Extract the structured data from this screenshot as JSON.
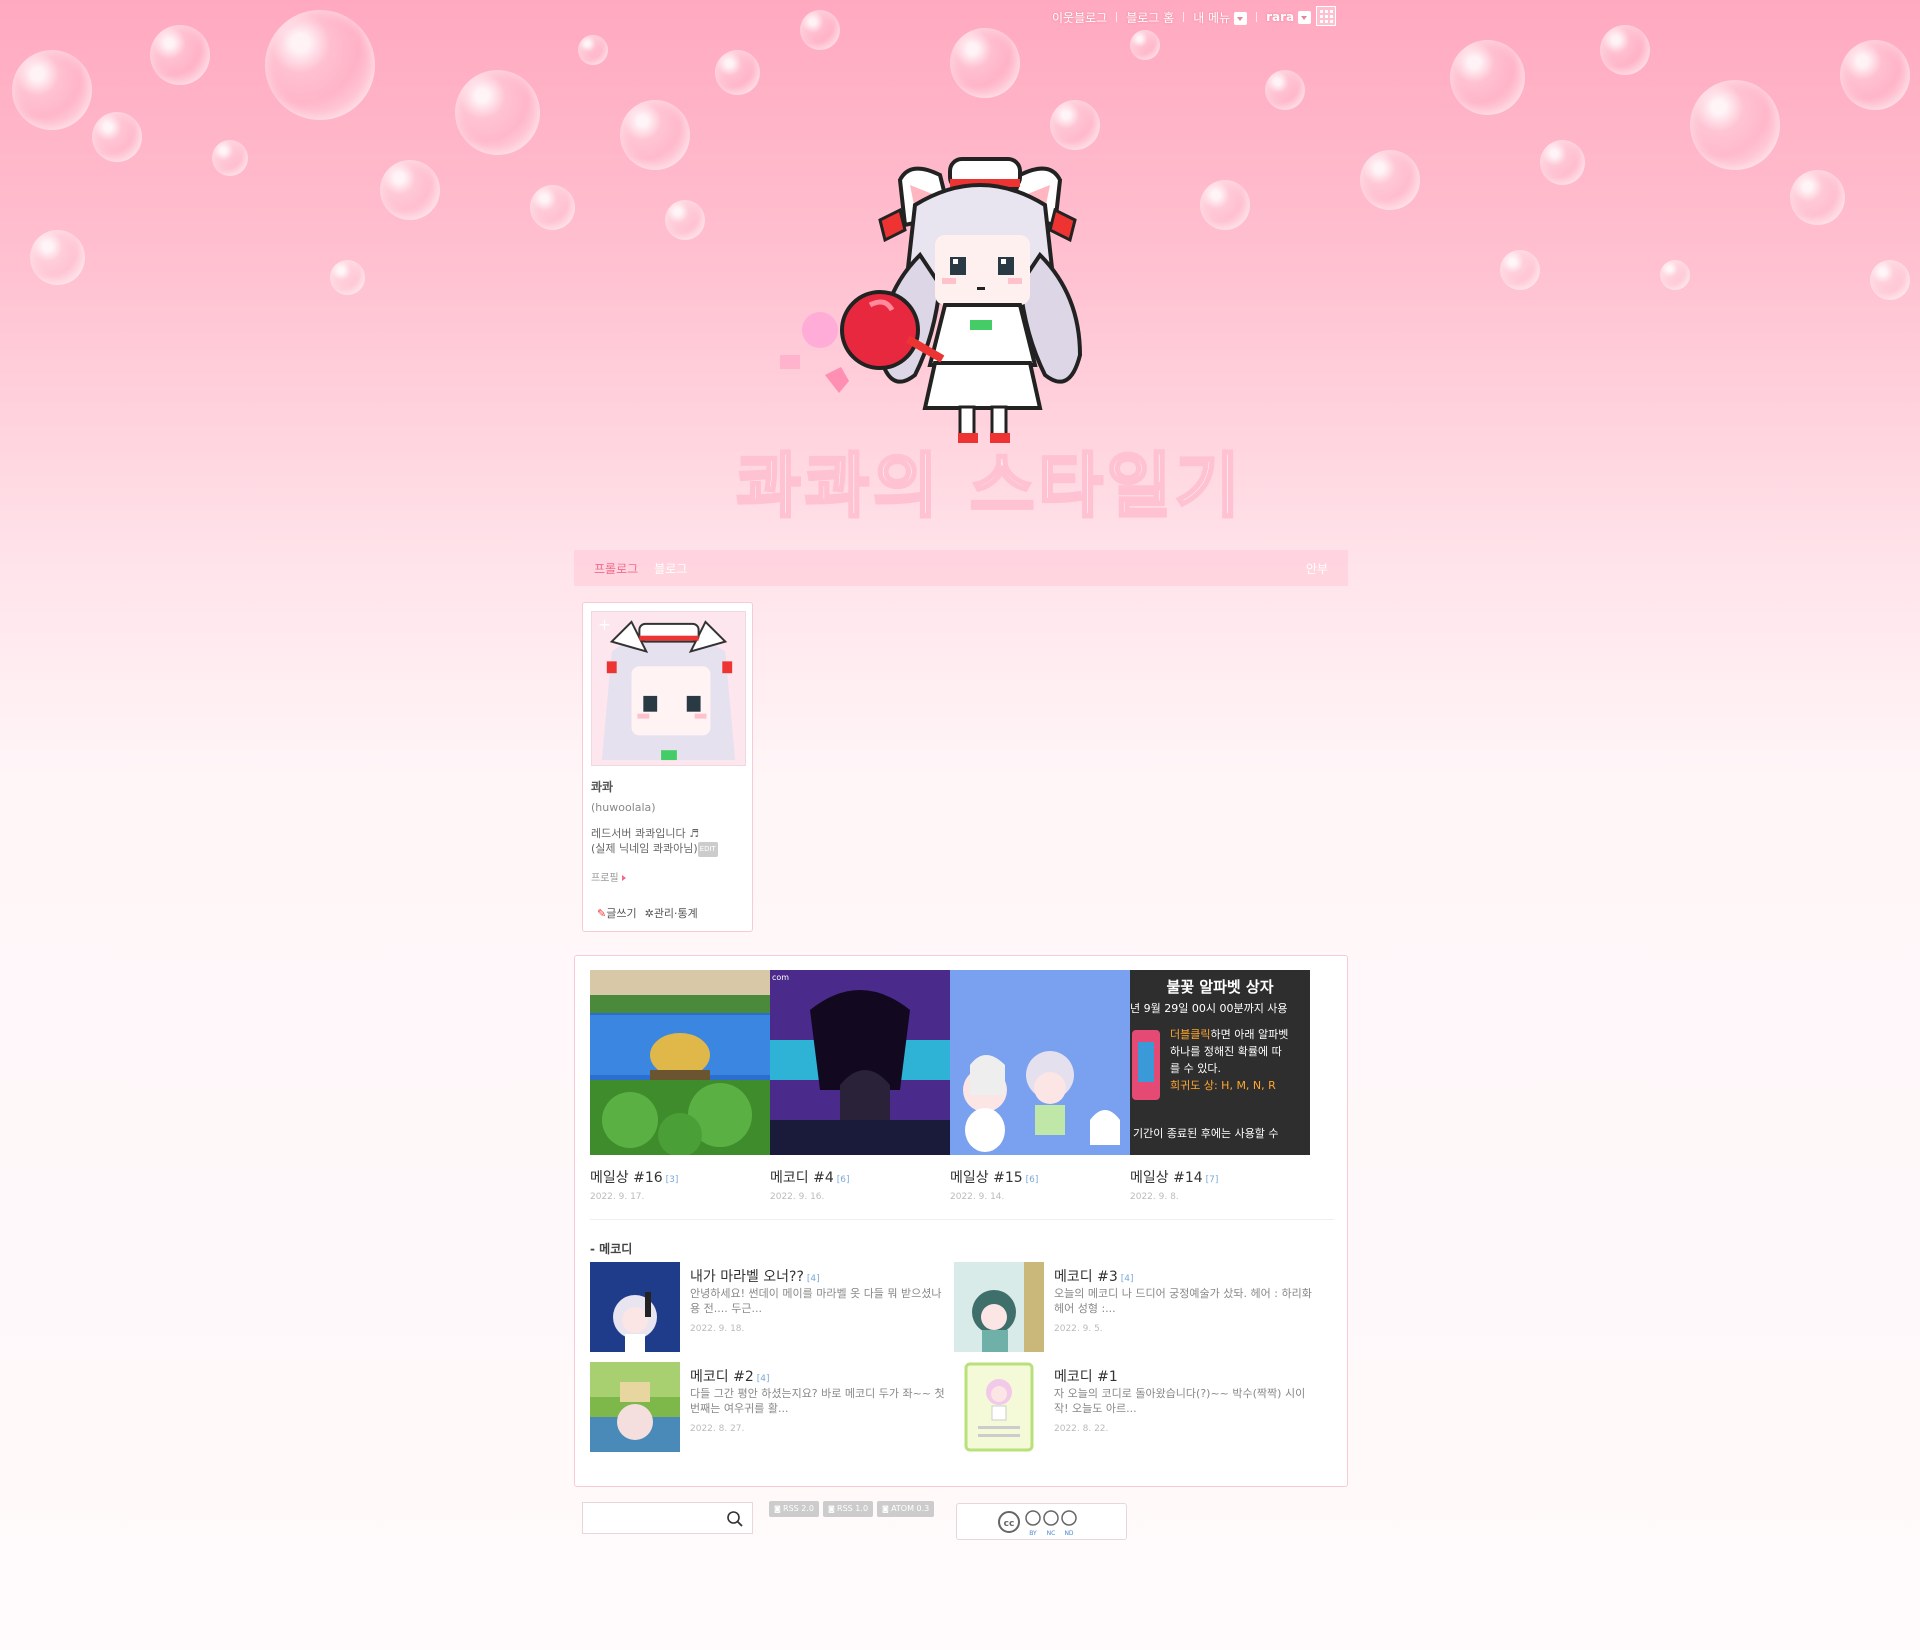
{
  "topnav": {
    "neighbor": "이웃블로그",
    "blog_home": "블로그 홈",
    "my_menu": "내 메뉴",
    "user": "rara"
  },
  "menu": {
    "tabs": [
      {
        "label": "프롤로그",
        "active": true
      },
      {
        "label": "블로그",
        "active": false
      }
    ],
    "right": "안부"
  },
  "profile": {
    "nickname": "콰콰",
    "id": "(huwoolala)",
    "desc_line1": "레드서버 콰콰입니다 ♬",
    "desc_line2": "(실제 닉네임 콰콰아님)",
    "edit": "EDIT",
    "profile_link": "프로필",
    "write": "글쓰기",
    "manage": "관리·통계"
  },
  "featured": [
    {
      "title": "메일상 #16",
      "count": "[3]",
      "date": "2022. 9. 17."
    },
    {
      "title": "메코디 #4",
      "count": "[6]",
      "date": "2022. 9. 16."
    },
    {
      "title": "메일상 #15",
      "count": "[6]",
      "date": "2022. 9. 14."
    },
    {
      "title": "메일상 #14",
      "count": "[7]",
      "date": "2022. 9. 8."
    }
  ],
  "thumb4_text": {
    "header": "불꽃 알파벳 상자",
    "line1": "년 9월 29일 00시 00분까지 사용",
    "line2a": "더블클릭",
    "line2b": "하면 아래 알파벳",
    "line3": "하나를 정해진 확률에 따",
    "line4": "를 수 있다.",
    "line5": "희귀도 상: H, M, N, R",
    "line6": "기간이 종료된 후에는 사용할 수"
  },
  "category": {
    "title": "- 메코디",
    "posts": [
      {
        "title": "내가 마라벨 오너??",
        "count": "[4]",
        "excerpt": "안녕하세요! 썬데이 메이를 마라벨 옷 다들 뭐 받으셨나용 전.... 두근...",
        "date": "2022. 9. 18."
      },
      {
        "title": "메코디 #3",
        "count": "[4]",
        "excerpt": "오늘의 메코디 나 드디어 궁정예술가 샀돠. 헤어 : 하리화 헤어 성형 :...",
        "date": "2022. 9. 5."
      },
      {
        "title": "메코디 #2",
        "count": "[4]",
        "excerpt": "다들 그간 평안 하셨는지요? 바로 메코디 두가 좌~~ 첫번째는 여우귀를 활...",
        "date": "2022. 8. 27."
      },
      {
        "title": "메코디 #1",
        "count": "",
        "excerpt": "자 오늘의 코디로 돌아왔습니다(?)~~ 박수(짝짝) 시이작! 오늘도 아르...",
        "date": "2022. 8. 22."
      }
    ]
  },
  "footer": {
    "search_placeholder": "",
    "feeds": [
      "RSS 2.0",
      "RSS 1.0",
      "ATOM 0.3"
    ],
    "cc_labels": [
      "BY",
      "NC",
      "ND"
    ]
  },
  "colors": {
    "accent": "#f06b8c",
    "count": "#7aa9d8",
    "border": "#f6cbd6"
  }
}
